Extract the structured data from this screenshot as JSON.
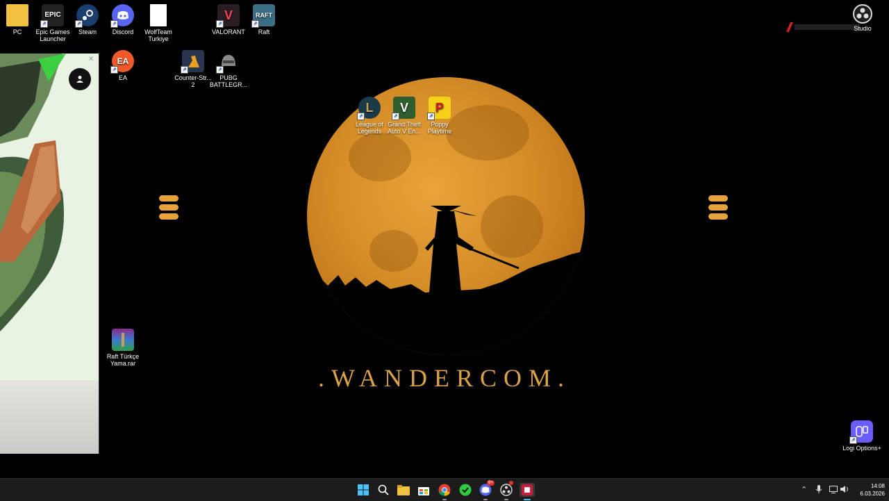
{
  "desktop": {
    "tagline": ".WANDERCOM.",
    "icons": [
      {
        "id": "pc",
        "label": "PC",
        "glyph": "",
        "color": "#f0c040"
      },
      {
        "id": "epic",
        "label": "Epic Games Launcher",
        "glyph": "EPIC",
        "color": "#222"
      },
      {
        "id": "steam",
        "label": "Steam",
        "glyph": "",
        "color": "#1b3d6e"
      },
      {
        "id": "discord",
        "label": "Discord",
        "glyph": "",
        "color": "#5865f2"
      },
      {
        "id": "wolfteam",
        "label": "WolfTeam Turkiye",
        "glyph": "",
        "color": "#ffffff"
      },
      {
        "id": "valorant",
        "label": "VALORANT",
        "glyph": "V",
        "color": "#fd4556"
      },
      {
        "id": "raft",
        "label": "Raft",
        "glyph": "RAFT",
        "color": "#3a6f87"
      },
      {
        "id": "ea",
        "label": "EA",
        "glyph": "EA",
        "color": "#f05a28"
      },
      {
        "id": "cs2",
        "label": "Counter-Str... 2",
        "glyph": "",
        "color": "#e8a020"
      },
      {
        "id": "pubg",
        "label": "PUBG BATTLEGR...",
        "glyph": "",
        "color": "#5a5a5a"
      },
      {
        "id": "lol",
        "label": "League of Legends",
        "glyph": "L",
        "color": "#1a3a48"
      },
      {
        "id": "gta",
        "label": "Grand Theft Auto V En...",
        "glyph": "V",
        "color": "#2f5f2f"
      },
      {
        "id": "poppy",
        "label": "Poppy Playtime",
        "glyph": "P",
        "color": "#f5d21a"
      },
      {
        "id": "raft-rar",
        "label": "Raft Türkçe Yama.rar",
        "glyph": "",
        "color": "#8b2a8b"
      },
      {
        "id": "logi",
        "label": "Logi Options+",
        "glyph": "",
        "color": "#6b5cff"
      }
    ],
    "obs_label": "Studio"
  },
  "taskbar": {
    "clock_time": "14:08",
    "clock_date": "6.03.2026",
    "discord_badge": "9+"
  }
}
